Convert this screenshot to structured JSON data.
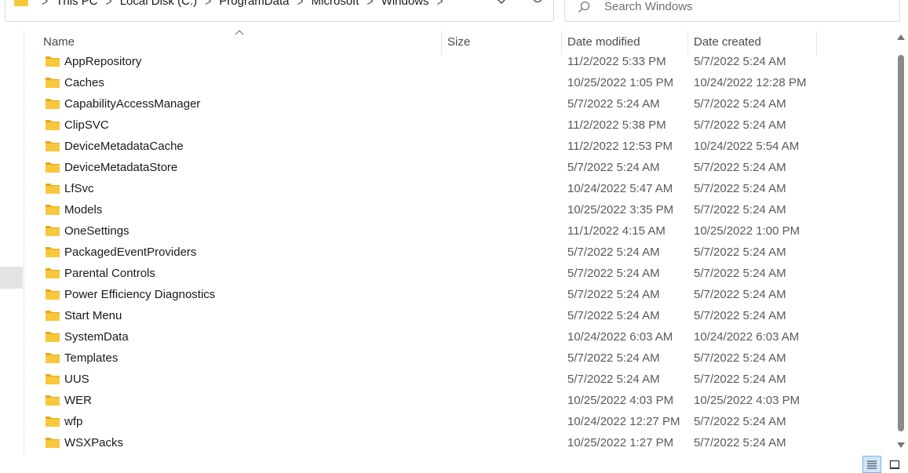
{
  "address_bar": {
    "breadcrumbs": [
      "This PC",
      "Local Disk (C:)",
      "ProgramData",
      "Microsoft",
      "Windows"
    ],
    "separator": ">"
  },
  "search": {
    "placeholder": "Search Windows"
  },
  "columns": {
    "name": "Name",
    "size": "Size",
    "date_modified": "Date modified",
    "date_created": "Date created"
  },
  "rows": [
    {
      "name": "AppRepository",
      "modified": "11/2/2022 5:33 PM",
      "created": "5/7/2022 5:24 AM"
    },
    {
      "name": "Caches",
      "modified": "10/25/2022 1:05 PM",
      "created": "10/24/2022 12:28 PM"
    },
    {
      "name": "CapabilityAccessManager",
      "modified": "5/7/2022 5:24 AM",
      "created": "5/7/2022 5:24 AM"
    },
    {
      "name": "ClipSVC",
      "modified": "11/2/2022 5:38 PM",
      "created": "5/7/2022 5:24 AM"
    },
    {
      "name": "DeviceMetadataCache",
      "modified": "11/2/2022 12:53 PM",
      "created": "10/24/2022 5:54 AM"
    },
    {
      "name": "DeviceMetadataStore",
      "modified": "5/7/2022 5:24 AM",
      "created": "5/7/2022 5:24 AM"
    },
    {
      "name": "LfSvc",
      "modified": "10/24/2022 5:47 AM",
      "created": "5/7/2022 5:24 AM"
    },
    {
      "name": "Models",
      "modified": "10/25/2022 3:35 PM",
      "created": "5/7/2022 5:24 AM"
    },
    {
      "name": "OneSettings",
      "modified": "11/1/2022 4:15 AM",
      "created": "10/25/2022 1:00 PM"
    },
    {
      "name": "PackagedEventProviders",
      "modified": "5/7/2022 5:24 AM",
      "created": "5/7/2022 5:24 AM"
    },
    {
      "name": "Parental Controls",
      "modified": "5/7/2022 5:24 AM",
      "created": "5/7/2022 5:24 AM"
    },
    {
      "name": "Power Efficiency Diagnostics",
      "modified": "5/7/2022 5:24 AM",
      "created": "5/7/2022 5:24 AM"
    },
    {
      "name": "Start Menu",
      "modified": "5/7/2022 5:24 AM",
      "created": "5/7/2022 5:24 AM"
    },
    {
      "name": "SystemData",
      "modified": "10/24/2022 6:03 AM",
      "created": "10/24/2022 6:03 AM"
    },
    {
      "name": "Templates",
      "modified": "5/7/2022 5:24 AM",
      "created": "5/7/2022 5:24 AM"
    },
    {
      "name": "UUS",
      "modified": "5/7/2022 5:24 AM",
      "created": "5/7/2022 5:24 AM"
    },
    {
      "name": "WER",
      "modified": "10/25/2022 4:03 PM",
      "created": "10/25/2022 4:03 PM"
    },
    {
      "name": "wfp",
      "modified": "10/24/2022 12:27 PM",
      "created": "5/7/2022 5:24 AM"
    },
    {
      "name": "WSXPacks",
      "modified": "10/25/2022 1:27 PM",
      "created": "5/7/2022 5:24 AM"
    }
  ],
  "icons": {
    "folder": "folder-icon",
    "dropdown": "chevron-down-icon",
    "refresh": "refresh-icon",
    "search": "search-icon",
    "sort": "sort-ascending-icon",
    "details_view": "details-view-icon",
    "tiles_view": "large-icons-view-icon"
  },
  "colors": {
    "folder": "#f8c83c",
    "folder_dark": "#e6a817",
    "selection": "#cfe4f7",
    "accent_border": "#7fb3e0"
  }
}
